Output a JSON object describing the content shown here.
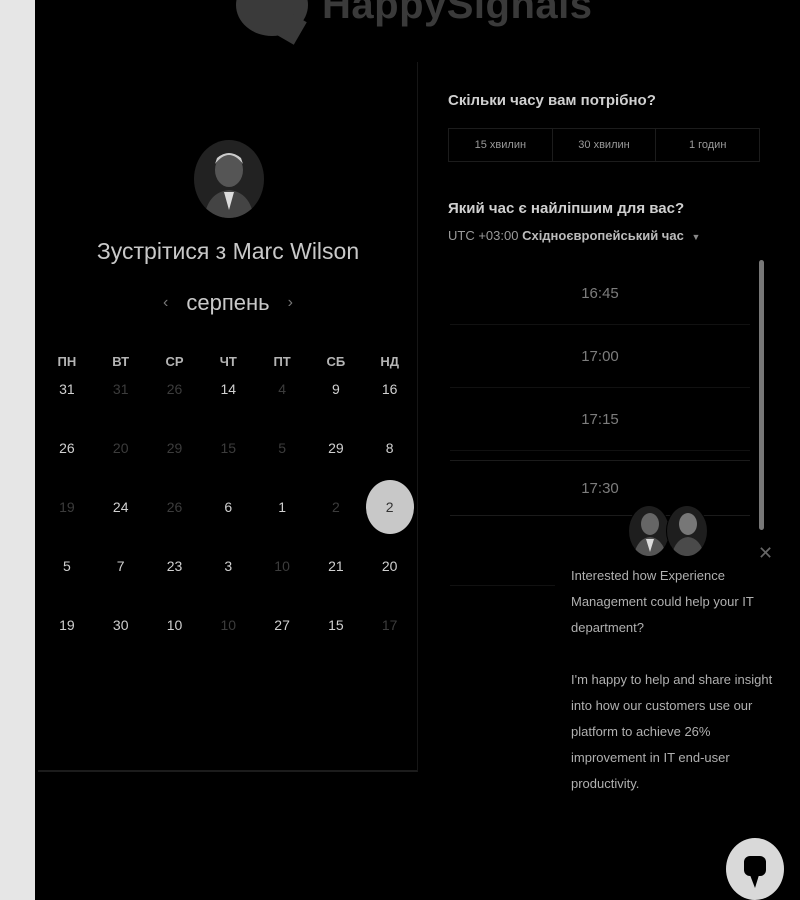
{
  "brand": {
    "name": "HappySignals"
  },
  "host": {
    "title": "Зустрітися з Marc Wilson"
  },
  "calendar": {
    "month": "серпень",
    "prev_icon": "chevron-left-icon",
    "next_icon": "chevron-right-icon",
    "weekdays": [
      "ПН",
      "ВТ",
      "СР",
      "ЧТ",
      "ПТ",
      "СБ",
      "НД"
    ],
    "weeks": [
      [
        {
          "d": "31",
          "m": false
        },
        {
          "d": "31",
          "m": true
        },
        {
          "d": "26",
          "m": true
        },
        {
          "d": "14",
          "m": false
        },
        {
          "d": "4",
          "m": true
        },
        {
          "d": "9",
          "m": false
        },
        {
          "d": "16",
          "m": false
        }
      ],
      [
        {
          "d": "26",
          "m": false
        },
        {
          "d": "20",
          "m": true
        },
        {
          "d": "29",
          "m": true
        },
        {
          "d": "15",
          "m": true
        },
        {
          "d": "5",
          "m": true
        },
        {
          "d": "29",
          "m": false
        },
        {
          "d": "8",
          "m": false
        }
      ],
      [
        {
          "d": "19",
          "m": true
        },
        {
          "d": "24",
          "m": false
        },
        {
          "d": "26",
          "m": true
        },
        {
          "d": "6",
          "m": false
        },
        {
          "d": "1",
          "m": false
        },
        {
          "d": "2",
          "m": true
        },
        {
          "d": "2",
          "m": false,
          "sel": true
        }
      ],
      [
        {
          "d": "5",
          "m": false
        },
        {
          "d": "7",
          "m": false
        },
        {
          "d": "23",
          "m": false
        },
        {
          "d": "3",
          "m": false
        },
        {
          "d": "10",
          "m": true
        },
        {
          "d": "21",
          "m": false
        },
        {
          "d": "20",
          "m": false
        }
      ],
      [
        {
          "d": "19",
          "m": false
        },
        {
          "d": "30",
          "m": false
        },
        {
          "d": "10",
          "m": false
        },
        {
          "d": "10",
          "m": true
        },
        {
          "d": "27",
          "m": false
        },
        {
          "d": "15",
          "m": false
        },
        {
          "d": "17",
          "m": true
        }
      ]
    ]
  },
  "duration": {
    "question": "Скільки часу вам потрібно?",
    "options": [
      "15 хвилин",
      "30 хвилин",
      "1 годин"
    ]
  },
  "time": {
    "question": "Який час є найліпшим для вас?",
    "tz_offset": "UTC +03:00",
    "tz_name": "Східноєвропейський час",
    "slots": [
      "16:45",
      "17:00",
      "17:15",
      "17:30"
    ]
  },
  "chat": {
    "message_1": "Interested how Experience Management could help your IT department?",
    "message_2": "I'm happy to help and share insight into how our customers use our platform to achieve 26% improvement in IT end-user productivity."
  },
  "colors": {
    "background": "#000000",
    "selected_day": "#c8c8c8",
    "gutter": "#e6e6e6"
  }
}
